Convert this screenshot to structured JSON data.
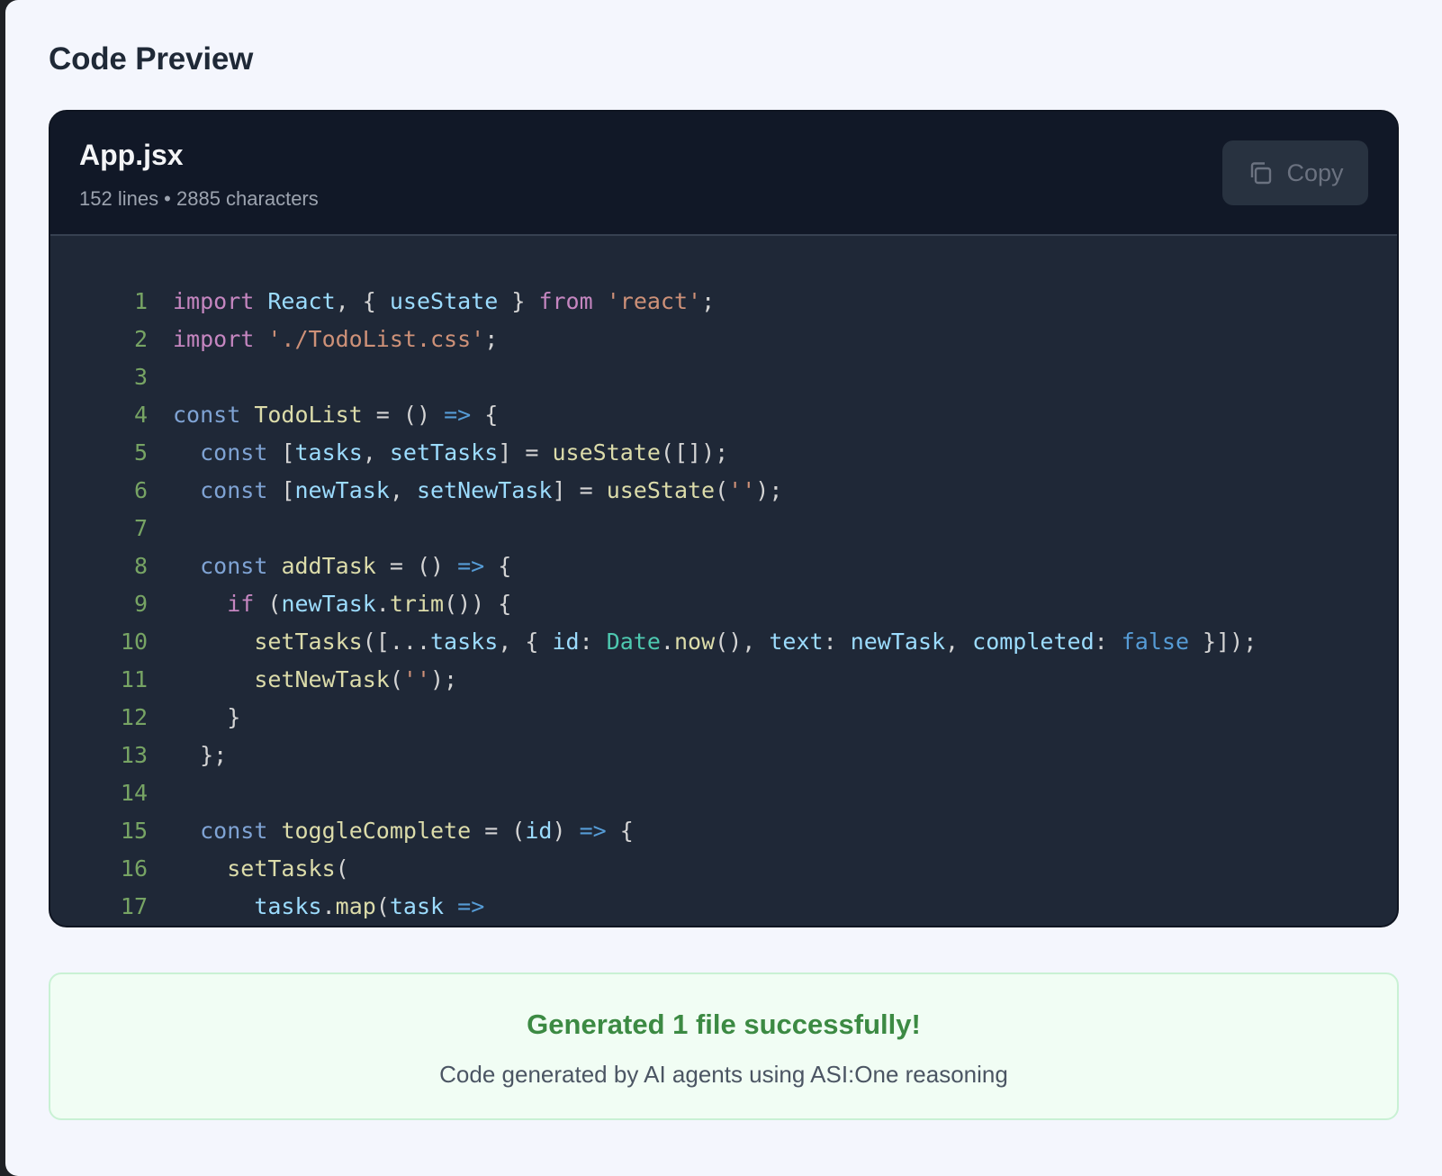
{
  "section": {
    "title": "Code Preview"
  },
  "file": {
    "name": "App.jsx",
    "meta": "152 lines • 2885 characters",
    "copy_label": "Copy",
    "copy_icon": "copy-icon"
  },
  "code_lines": [
    {
      "n": "1",
      "tokens": [
        [
          "kw",
          "import"
        ],
        [
          "plain",
          " "
        ],
        [
          "var",
          "React"
        ],
        [
          "plain",
          ", { "
        ],
        [
          "var",
          "useState"
        ],
        [
          "plain",
          " } "
        ],
        [
          "kw",
          "from"
        ],
        [
          "plain",
          " "
        ],
        [
          "str",
          "'react'"
        ],
        [
          "plain",
          ";"
        ]
      ]
    },
    {
      "n": "2",
      "tokens": [
        [
          "kw",
          "import"
        ],
        [
          "plain",
          " "
        ],
        [
          "str",
          "'./TodoList.css'"
        ],
        [
          "plain",
          ";"
        ]
      ]
    },
    {
      "n": "3",
      "tokens": []
    },
    {
      "n": "4",
      "tokens": [
        [
          "decl",
          "const"
        ],
        [
          "plain",
          " "
        ],
        [
          "fn",
          "TodoList"
        ],
        [
          "plain",
          " = () "
        ],
        [
          "arrow",
          "=>"
        ],
        [
          "plain",
          " {"
        ]
      ]
    },
    {
      "n": "5",
      "tokens": [
        [
          "plain",
          "  "
        ],
        [
          "decl",
          "const"
        ],
        [
          "plain",
          " ["
        ],
        [
          "var",
          "tasks"
        ],
        [
          "plain",
          ", "
        ],
        [
          "var",
          "setTasks"
        ],
        [
          "plain",
          "] = "
        ],
        [
          "fn",
          "useState"
        ],
        [
          "plain",
          "([]);"
        ]
      ]
    },
    {
      "n": "6",
      "tokens": [
        [
          "plain",
          "  "
        ],
        [
          "decl",
          "const"
        ],
        [
          "plain",
          " ["
        ],
        [
          "var",
          "newTask"
        ],
        [
          "plain",
          ", "
        ],
        [
          "var",
          "setNewTask"
        ],
        [
          "plain",
          "] = "
        ],
        [
          "fn",
          "useState"
        ],
        [
          "plain",
          "("
        ],
        [
          "str",
          "''"
        ],
        [
          "plain",
          ");"
        ]
      ]
    },
    {
      "n": "7",
      "tokens": []
    },
    {
      "n": "8",
      "tokens": [
        [
          "plain",
          "  "
        ],
        [
          "decl",
          "const"
        ],
        [
          "plain",
          " "
        ],
        [
          "fn",
          "addTask"
        ],
        [
          "plain",
          " = () "
        ],
        [
          "arrow",
          "=>"
        ],
        [
          "plain",
          " {"
        ]
      ]
    },
    {
      "n": "9",
      "tokens": [
        [
          "plain",
          "    "
        ],
        [
          "kw",
          "if"
        ],
        [
          "plain",
          " ("
        ],
        [
          "var",
          "newTask"
        ],
        [
          "plain",
          "."
        ],
        [
          "fn",
          "trim"
        ],
        [
          "plain",
          "()) {"
        ]
      ]
    },
    {
      "n": "10",
      "tokens": [
        [
          "plain",
          "      "
        ],
        [
          "fn",
          "setTasks"
        ],
        [
          "plain",
          "([..."
        ],
        [
          "var",
          "tasks"
        ],
        [
          "plain",
          ", { "
        ],
        [
          "var",
          "id"
        ],
        [
          "plain",
          ": "
        ],
        [
          "class",
          "Date"
        ],
        [
          "plain",
          "."
        ],
        [
          "fn",
          "now"
        ],
        [
          "plain",
          "(), "
        ],
        [
          "var",
          "text"
        ],
        [
          "plain",
          ": "
        ],
        [
          "var",
          "newTask"
        ],
        [
          "plain",
          ", "
        ],
        [
          "var",
          "completed"
        ],
        [
          "plain",
          ": "
        ],
        [
          "bool",
          "false"
        ],
        [
          "plain",
          " }]);"
        ]
      ]
    },
    {
      "n": "11",
      "tokens": [
        [
          "plain",
          "      "
        ],
        [
          "fn",
          "setNewTask"
        ],
        [
          "plain",
          "("
        ],
        [
          "str",
          "''"
        ],
        [
          "plain",
          ");"
        ]
      ]
    },
    {
      "n": "12",
      "tokens": [
        [
          "plain",
          "    }"
        ]
      ]
    },
    {
      "n": "13",
      "tokens": [
        [
          "plain",
          "  };"
        ]
      ]
    },
    {
      "n": "14",
      "tokens": []
    },
    {
      "n": "15",
      "tokens": [
        [
          "plain",
          "  "
        ],
        [
          "decl",
          "const"
        ],
        [
          "plain",
          " "
        ],
        [
          "fn",
          "toggleComplete"
        ],
        [
          "plain",
          " = ("
        ],
        [
          "var",
          "id"
        ],
        [
          "plain",
          ") "
        ],
        [
          "arrow",
          "=>"
        ],
        [
          "plain",
          " {"
        ]
      ]
    },
    {
      "n": "16",
      "tokens": [
        [
          "plain",
          "    "
        ],
        [
          "fn",
          "setTasks"
        ],
        [
          "plain",
          "("
        ]
      ]
    },
    {
      "n": "17",
      "tokens": [
        [
          "plain",
          "      "
        ],
        [
          "var",
          "tasks"
        ],
        [
          "plain",
          "."
        ],
        [
          "fn",
          "map"
        ],
        [
          "plain",
          "("
        ],
        [
          "var",
          "task"
        ],
        [
          "plain",
          " "
        ],
        [
          "arrow",
          "=>"
        ]
      ]
    }
  ],
  "status": {
    "title": "Generated 1 file successfully!",
    "subtitle": "Code generated by AI agents using ASI:One reasoning"
  },
  "colors": {
    "page_bg": "#f4f6fd",
    "code_bg": "#1f2837",
    "header_bg": "#111827",
    "success_bg": "#f1fdf4",
    "success_text": "#3c8a43",
    "line_number": "#77a464"
  }
}
